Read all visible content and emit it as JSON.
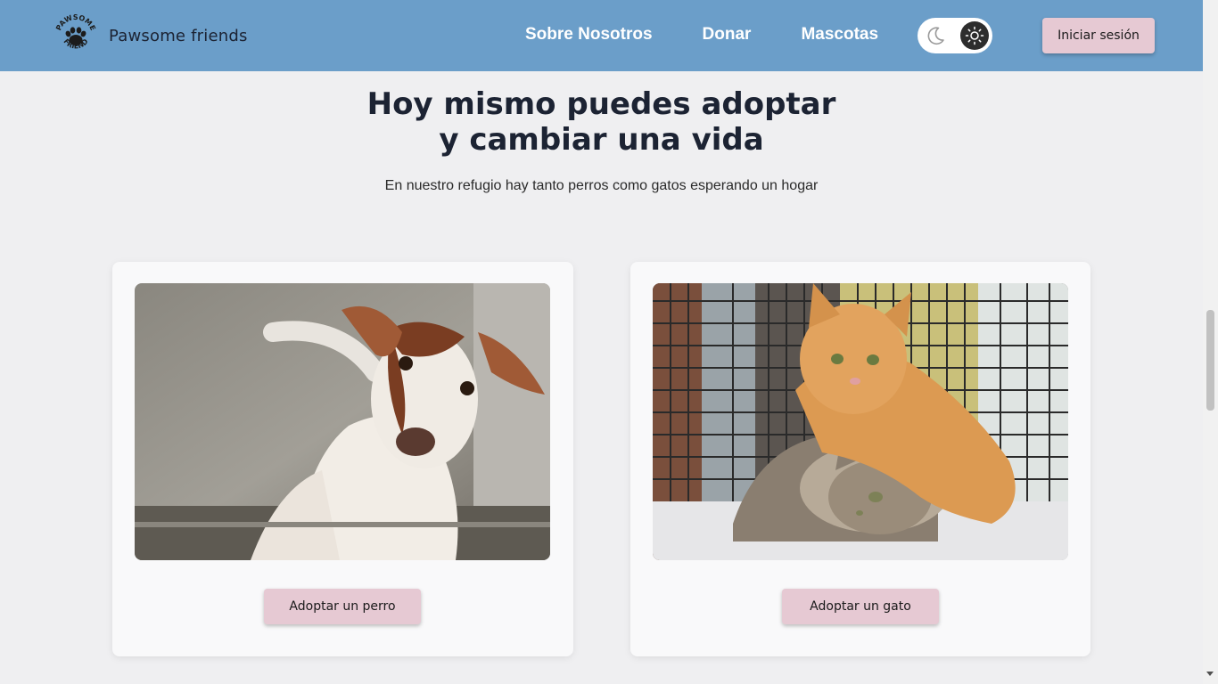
{
  "header": {
    "brand_name": "Pawsome friends",
    "logo_text_top": "PAWSOME",
    "logo_text_bottom": "FRIEND",
    "nav": [
      {
        "label": "Sobre Nosotros"
      },
      {
        "label": "Donar"
      },
      {
        "label": "Mascotas"
      }
    ],
    "theme_toggle": {
      "options": [
        "moon-icon",
        "sun-icon"
      ],
      "active": "sun-icon"
    },
    "login_label": "Iniciar sesión"
  },
  "hero": {
    "title": "Hoy mismo puedes adoptar\ny cambiar una vida",
    "subtitle": "En nuestro refugio hay tanto perros como gatos esperando un hogar"
  },
  "cards": [
    {
      "image": "puppy-photo",
      "button_label": "Adoptar un perro"
    },
    {
      "image": "cats-photo",
      "button_label": "Adoptar un gato"
    }
  ],
  "colors": {
    "header_bg": "#6b9ec9",
    "button_bg": "#e6c9d3",
    "page_bg": "#efeff1",
    "card_bg": "#f9f9fa"
  }
}
